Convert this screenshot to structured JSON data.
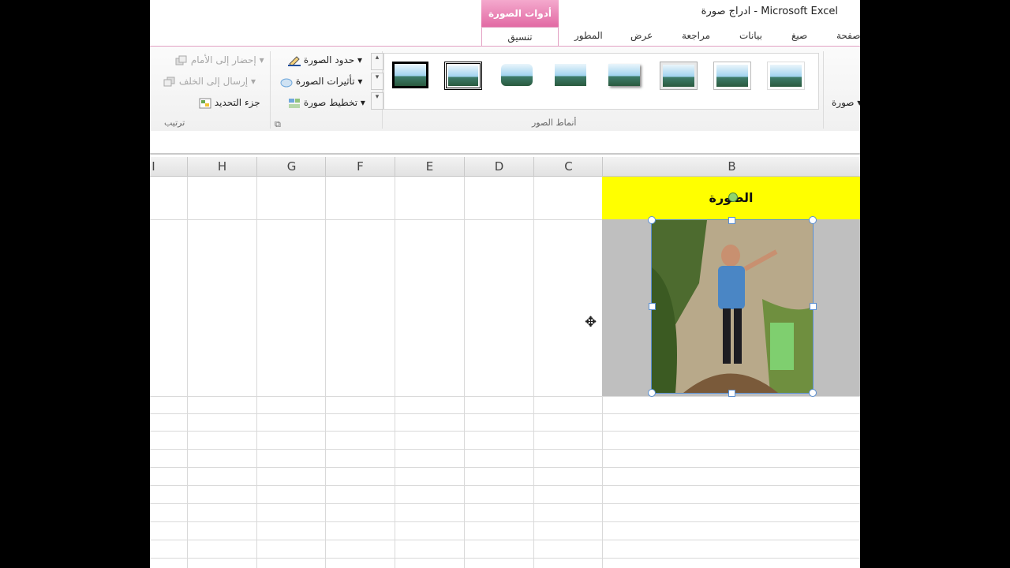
{
  "window": {
    "title": "Microsoft Excel - ادراج صورة"
  },
  "contextual_tab": {
    "header": "أدوات الصورة",
    "tab": "تنسيق"
  },
  "tabs": [
    "المطور",
    "عرض",
    "مراجعة",
    "بيانات",
    "صيغ",
    "صفحة"
  ],
  "ribbon": {
    "arrange": {
      "label": "ترتيب",
      "bring_forward": "إحضار إلى الأمام",
      "send_backward": "إرسال إلى الخلف",
      "selection_pane": "جزء التحديد"
    },
    "picture": {
      "border": "حدود الصورة",
      "effects": "تأثيرات الصورة",
      "layout": "تخطيط صورة"
    },
    "styles": {
      "label": "أنماط الصور"
    },
    "adjust_partial": "صورة"
  },
  "sheet": {
    "columns": [
      "I",
      "H",
      "G",
      "F",
      "E",
      "D",
      "C",
      "B"
    ],
    "cell_b1": "الصورة"
  }
}
